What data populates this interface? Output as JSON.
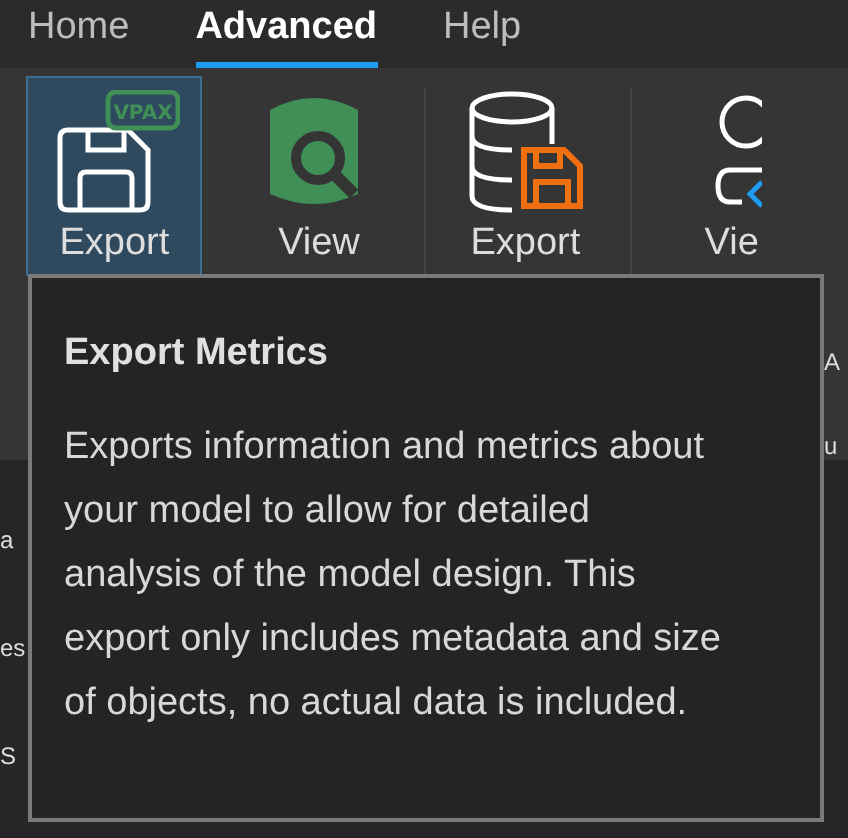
{
  "tabs": [
    {
      "label": "Home",
      "selected": false
    },
    {
      "label": "Advanced",
      "selected": true
    },
    {
      "label": "Help",
      "selected": false
    }
  ],
  "ribbon": [
    {
      "kind": "vpax",
      "label": "Export",
      "selected": true,
      "badge": "VPAX"
    },
    {
      "kind": "view",
      "label": "View",
      "selected": false
    },
    {
      "kind": "dbsave",
      "label": "Export",
      "selected": false
    },
    {
      "kind": "user",
      "label": "Vie",
      "extra": [
        "A",
        "u"
      ],
      "selected": false
    }
  ],
  "side_fragments": [
    "a",
    "es",
    "S"
  ],
  "tooltip": {
    "title": "Export Metrics",
    "body": "Exports information and metrics about your model to allow for detailed analysis of the model design. This export only includes metadata and size of objects, no actual data is included."
  }
}
